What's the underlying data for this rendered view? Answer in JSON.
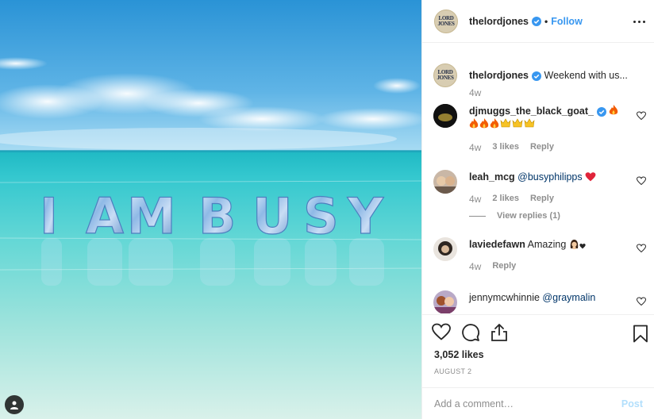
{
  "header": {
    "username": "thelordjones",
    "separator": "•",
    "follow_label": "Follow",
    "avatar_text": "LORD JONES"
  },
  "photo": {
    "balloon_text": [
      "I",
      "A",
      "M",
      "B",
      "U",
      "S",
      "Y"
    ]
  },
  "caption": {
    "username": "thelordjones",
    "text": "Weekend with us...",
    "time": "4w"
  },
  "comments": [
    {
      "username": "djmuggs_the_black_goat_",
      "verified": true,
      "time": "4w",
      "likes": "3 likes",
      "reply": "Reply"
    },
    {
      "username": "leah_mcg",
      "mention": "@busyphilipps",
      "time": "4w",
      "likes": "2 likes",
      "reply": "Reply",
      "view_replies": "View replies (1)"
    },
    {
      "username": "laviedefawn",
      "text": "Amazing",
      "time": "4w",
      "reply": "Reply"
    },
    {
      "username": "jennymcwhinnie",
      "mention": "@graymalin"
    }
  ],
  "footer": {
    "likes": "3,052 likes",
    "date": "AUGUST 2",
    "add_comment_placeholder": "Add a comment…",
    "post_label": "Post"
  },
  "colors": {
    "accent": "#3897f0",
    "verified": "#3897f0",
    "heart_red": "#ed4956",
    "muted": "#8e8e8e"
  },
  "icons": [
    "verified-badge-icon",
    "more-options-icon",
    "heart-icon",
    "comment-icon",
    "share-icon",
    "bookmark-icon",
    "user-tag-icon",
    "fire-emoji",
    "crown-emoji",
    "red-heart-emoji"
  ]
}
